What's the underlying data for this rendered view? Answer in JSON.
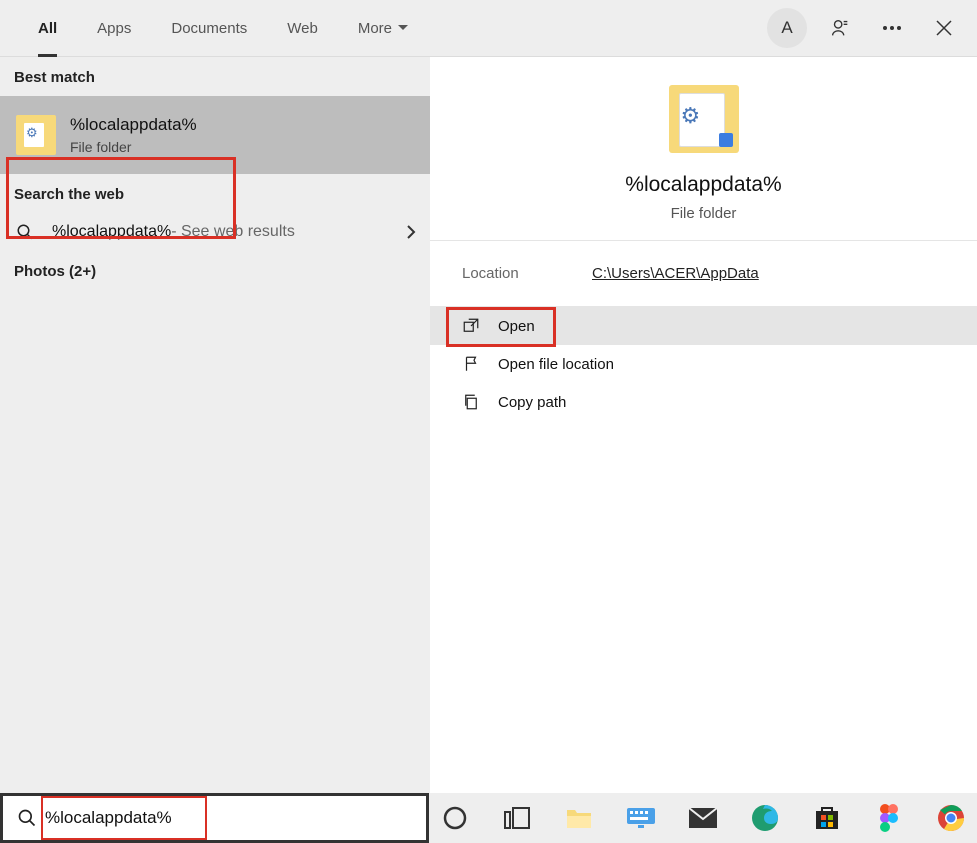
{
  "topbar": {
    "tabs": [
      "All",
      "Apps",
      "Documents",
      "Web",
      "More"
    ],
    "active_tab_index": 0,
    "avatar_letter": "A"
  },
  "left": {
    "best_match_header": "Best match",
    "best_match": {
      "title": "%localappdata%",
      "subtitle": "File folder"
    },
    "search_web_header": "Search the web",
    "web_result": {
      "query": "%localappdata%",
      "suffix": " - See web results"
    },
    "photos_header": "Photos (2+)"
  },
  "right": {
    "title": "%localappdata%",
    "subtitle": "File folder",
    "location_label": "Location",
    "location_value": "C:\\Users\\ACER\\AppData",
    "actions": [
      {
        "label": "Open",
        "icon": "open"
      },
      {
        "label": "Open file location",
        "icon": "file-loc"
      },
      {
        "label": "Copy path",
        "icon": "copy"
      }
    ]
  },
  "search": {
    "value": "%localappdata%"
  },
  "taskbar_icons": [
    "cortana",
    "task-view",
    "file-explorer",
    "keyboard",
    "mail",
    "edge",
    "store",
    "figma",
    "chrome"
  ]
}
